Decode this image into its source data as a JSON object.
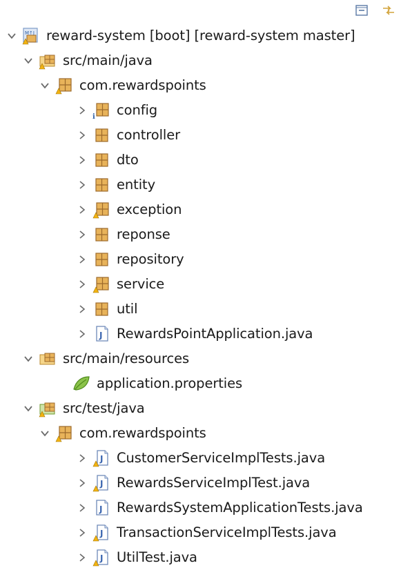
{
  "toolbar": {
    "collapse_all": "collapse-all-icon",
    "link_editor": "link-with-editor-icon"
  },
  "colors": {
    "package_brown": "#9c6a2c",
    "package_fill": "#e8b35a",
    "chevron": "#6b6b6b",
    "warning": "#f2b312"
  },
  "tree": {
    "project": "reward-system [boot] [reward-system master]",
    "src_main_java": "src/main/java",
    "pkg_main": "com.rewardspoints",
    "config": "config",
    "controller": "controller",
    "dto": "dto",
    "entity": "entity",
    "exception": "exception",
    "reponse": "reponse",
    "repository": "repository",
    "service": "service",
    "util": "util",
    "main_class": "RewardsPointApplication.java",
    "src_main_resources": "src/main/resources",
    "app_props": "application.properties",
    "src_test_java": "src/test/java",
    "pkg_test": "com.rewardspoints",
    "test1": "CustomerServiceImplTests.java",
    "test2": "RewardsServiceImplTest.java",
    "test3": "RewardsSystemApplicationTests.java",
    "test4": "TransactionServiceImplTests.java",
    "test5": "UtilTest.java"
  }
}
